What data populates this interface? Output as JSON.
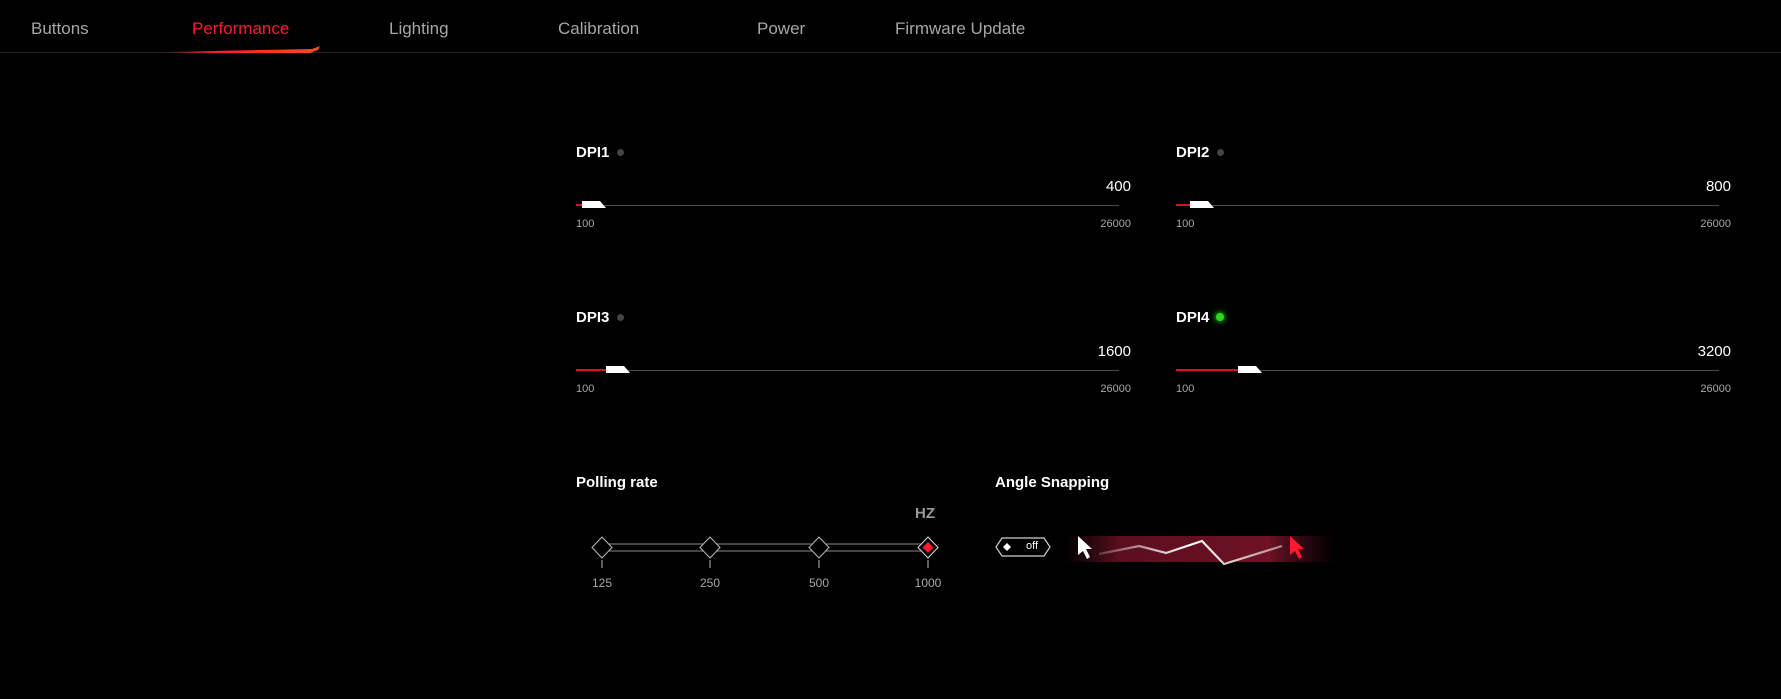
{
  "tabs": [
    {
      "label": "Buttons",
      "active": false
    },
    {
      "label": "Performance",
      "active": true
    },
    {
      "label": "Lighting",
      "active": false
    },
    {
      "label": "Calibration",
      "active": false
    },
    {
      "label": "Power",
      "active": false
    },
    {
      "label": "Firmware Update",
      "active": false
    }
  ],
  "dpi": [
    {
      "label": "DPI1",
      "value": "400",
      "min": "100",
      "max": "26000",
      "level": 0.0115,
      "active": false
    },
    {
      "label": "DPI2",
      "value": "800",
      "min": "100",
      "max": "26000",
      "level": 0.027,
      "active": false
    },
    {
      "label": "DPI3",
      "value": "1600",
      "min": "100",
      "max": "26000",
      "level": 0.058,
      "active": false
    },
    {
      "label": "DPI4",
      "value": "3200",
      "min": "100",
      "max": "26000",
      "level": 0.12,
      "active": true
    }
  ],
  "polling": {
    "title": "Polling rate",
    "unit": "HZ",
    "options": [
      "125",
      "250",
      "500",
      "1000"
    ],
    "selected": "1000"
  },
  "angle_snapping": {
    "title": "Angle Snapping",
    "toggle_label": "off",
    "enabled": false
  },
  "colors": {
    "accent": "#ff1a2e",
    "track_fill": "#d2121f",
    "active_dot": "#2cd61b",
    "inactive_dot": "#444444",
    "muted_text": "#a6a6a6"
  },
  "icons": [
    "cursor-white-icon",
    "cursor-red-icon",
    "diamond-icon"
  ]
}
